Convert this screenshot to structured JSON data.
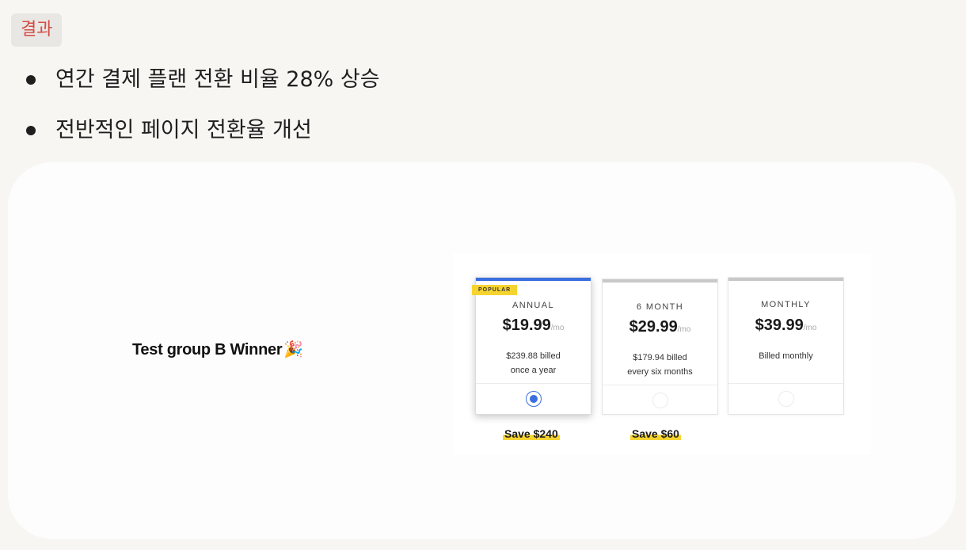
{
  "section_tag": "결과",
  "bullets": [
    "연간 결제 플랜 전환 비율 28% 상승",
    "전반적인 페이지 전환율 개선"
  ],
  "winner_label": "Test group B Winner",
  "winner_emoji": "🎉",
  "pricing": {
    "popular_badge": "POPULAR",
    "plans": [
      {
        "name": "ANNUAL",
        "price": "$19.99",
        "per": "/mo",
        "billed_line1": "$239.88 billed",
        "billed_line2": "once a year",
        "selected": true,
        "save": "Save $240"
      },
      {
        "name": "6 MONTH",
        "price": "$29.99",
        "per": "/mo",
        "billed_line1": "$179.94 billed",
        "billed_line2": "every six months",
        "selected": false,
        "save": "Save $60"
      },
      {
        "name": "MONTHLY",
        "price": "$39.99",
        "per": "/mo",
        "billed_line1": "Billed monthly",
        "billed_line2": "",
        "selected": false,
        "save": ""
      }
    ]
  },
  "colors": {
    "tag_text": "#d44c47",
    "selected_accent": "#3a6fe0",
    "highlight": "#f6d430"
  }
}
